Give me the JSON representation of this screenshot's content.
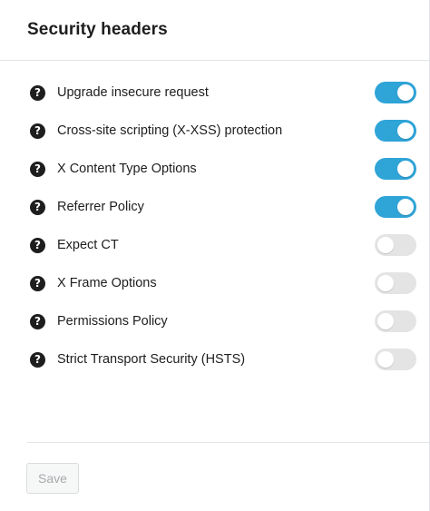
{
  "header": {
    "title": "Security headers"
  },
  "help_icon": {
    "glyph": "?",
    "icon": "help-circle-icon"
  },
  "settings": [
    {
      "label": "Upgrade insecure request",
      "enabled": true
    },
    {
      "label": "Cross-site scripting (X-XSS) protection",
      "enabled": true
    },
    {
      "label": "X Content Type Options",
      "enabled": true
    },
    {
      "label": "Referrer Policy",
      "enabled": true
    },
    {
      "label": "Expect CT",
      "enabled": false
    },
    {
      "label": "X Frame Options",
      "enabled": false
    },
    {
      "label": "Permissions Policy",
      "enabled": false
    },
    {
      "label": "Strict Transport Security (HSTS)",
      "enabled": false
    }
  ],
  "footer": {
    "save_label": "Save",
    "save_disabled": true
  },
  "colors": {
    "toggle_on": "#2fa4d7",
    "toggle_off": "#e4e4e4",
    "icon": "#1e1e1e"
  }
}
